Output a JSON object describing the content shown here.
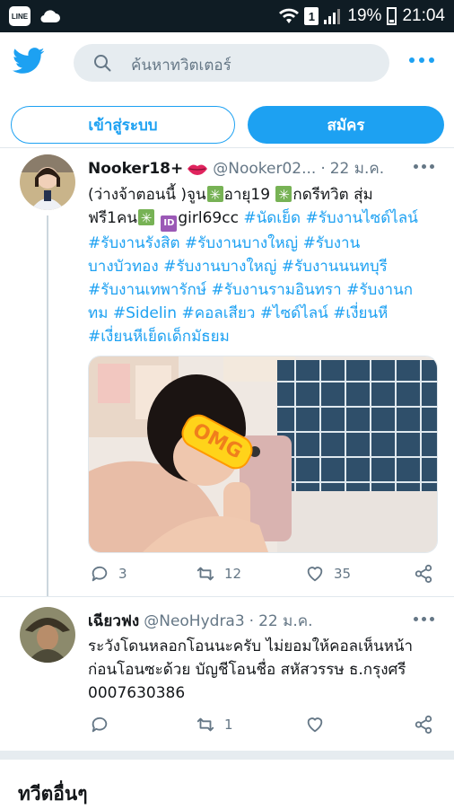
{
  "status_bar": {
    "battery": "19%",
    "time": "21:04",
    "sim_label": "1",
    "line_app_label": "LINE"
  },
  "header": {
    "logo_icon": "twitter-bird-icon",
    "search_placeholder": "ค้นหาทวิตเตอร์",
    "menu_icon": "more-dots-icon"
  },
  "auth": {
    "login_label": "เข้าสู่ระบบ",
    "signup_label": "สมัคร"
  },
  "tweets": [
    {
      "name": "Nooker18+",
      "handle": "@Nooker02...",
      "separator": "·",
      "date": "22 ม.ค.",
      "text": {
        "p1": "(ว่างจ้าตอนนี้ )จูน",
        "p2": "อายุ19 ",
        "p3": "กดรีทวิต สุ่มฟรี1คน",
        "p4": "girl69cc ",
        "tags": [
          "#นัดเย็ด",
          "#รับงานไซด์ไลน์",
          "#รับงานรังสิต",
          "#รับงานบางใหญ่",
          "#รับงานบางบัวทอง",
          "#รับงานบางใหญ่",
          "#รับงานนนทบุรี",
          "#รับงานเทพารักษ์",
          "#รับงานรามอินทรา",
          "#รับงานกทม",
          "#Sidelin",
          "#คอลเสียว",
          "#ไซด์ไลน์",
          "#เงี่ยนหี",
          "#เงี่ยนหีเย็ดเด็กมัธยม"
        ]
      },
      "media_sticker_text": "OMG",
      "replies": "3",
      "retweets": "12",
      "likes": "35"
    },
    {
      "name": "เฉียวฟง",
      "handle": "@NeoHydra3",
      "separator": "·",
      "date": "22 ม.ค.",
      "text_line1": "ระวังโดนหลอกโอนนะครับ ไม่ยอมให้คอลเห็นหน้า",
      "text_line2": "ก่อนโอนซะด้วย  บัญชีโอนชื่อ สหัสวรรษ ธ.กรุงศรี",
      "text_line3": "0007630386",
      "replies": "",
      "retweets": "1",
      "likes": ""
    }
  ],
  "more_tweets_title": "ทวีตอื่นๆ",
  "colors": {
    "accent": "#1da1f2",
    "status_bar": "#0f1c24",
    "secondary_text": "#657786"
  }
}
